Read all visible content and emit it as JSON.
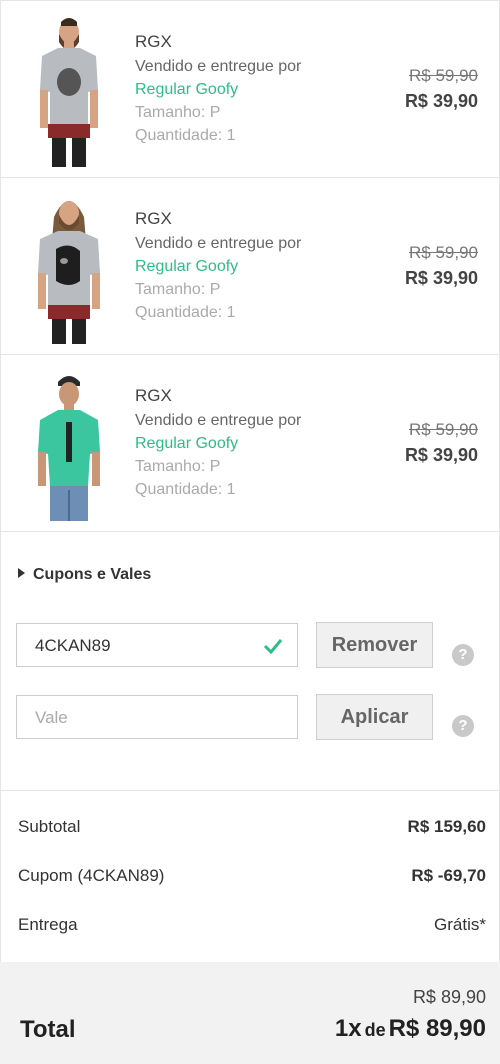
{
  "items": [
    {
      "brand": "RGX",
      "sold_by": "Vendido e entregue por",
      "seller": "Regular Goofy",
      "size": "Tamanho: P",
      "qty": "Quantidade: 1",
      "old_price": "R$ 59,90",
      "price": "R$ 39,90",
      "image": "gray-tshirt-skull-print-model",
      "shirt_color": "#b8bcc0"
    },
    {
      "brand": "RGX",
      "sold_by": "Vendido e entregue por",
      "seller": "Regular Goofy",
      "size": "Tamanho: P",
      "qty": "Quantidade: 1",
      "old_price": "R$ 59,90",
      "price": "R$ 39,90",
      "image": "gray-tshirt-face-print-model",
      "shirt_color": "#b8bcc0"
    },
    {
      "brand": "RGX",
      "sold_by": "Vendido e entregue por",
      "seller": "Regular Goofy",
      "size": "Tamanho: P",
      "qty": "Quantidade: 1",
      "old_price": "R$ 59,90",
      "price": "R$ 39,90",
      "image": "green-tshirt-print-model",
      "shirt_color": "#3cc6a0"
    }
  ],
  "coupons": {
    "toggle_label": "Cupons e Vales",
    "coupon_value": "4CKAN89",
    "remove_label": "Remover",
    "voucher_placeholder": "Vale",
    "apply_label": "Aplicar",
    "help_glyph": "?"
  },
  "summary": {
    "subtotal_label": "Subtotal",
    "subtotal_value": "R$ 159,60",
    "coupon_label": "Cupom (4CKAN89)",
    "coupon_value": "R$ -69,70",
    "shipping_label": "Entrega",
    "shipping_value": "Grátis*"
  },
  "total": {
    "label": "Total",
    "cash_value": "R$ 89,90",
    "installments": "1x",
    "de": "de",
    "installment_value": "R$ 89,90"
  },
  "colors": {
    "accent_green": "#2ebd85",
    "border": "#e5e5e5"
  }
}
